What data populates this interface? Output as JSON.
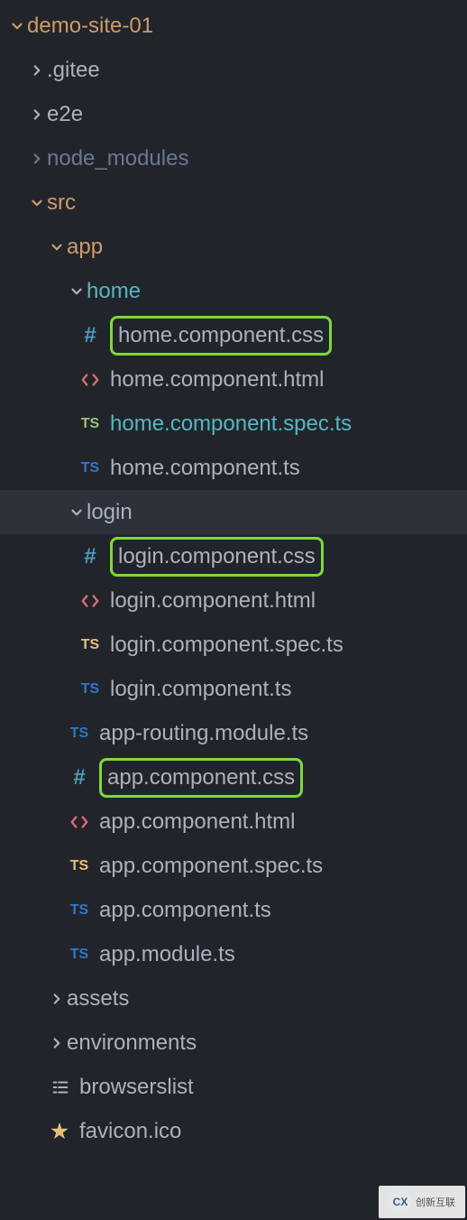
{
  "tree": {
    "root": "demo-site-01",
    "gitee": ".gitee",
    "e2e": "e2e",
    "node_modules": "node_modules",
    "src": "src",
    "app": "app",
    "home": "home",
    "home_css": "home.component.css",
    "home_html": "home.component.html",
    "home_spec": "home.component.spec.ts",
    "home_ts": "home.component.ts",
    "login": "login",
    "login_css": "login.component.css",
    "login_html": "login.component.html",
    "login_spec": "login.component.spec.ts",
    "login_ts": "login.component.ts",
    "app_routing": "app-routing.module.ts",
    "app_css": "app.component.css",
    "app_html": "app.component.html",
    "app_spec": "app.component.spec.ts",
    "app_ts": "app.component.ts",
    "app_module": "app.module.ts",
    "assets": "assets",
    "environments": "environments",
    "browserslist": "browserslist",
    "favicon": "favicon.ico"
  },
  "watermark": "创新互联"
}
